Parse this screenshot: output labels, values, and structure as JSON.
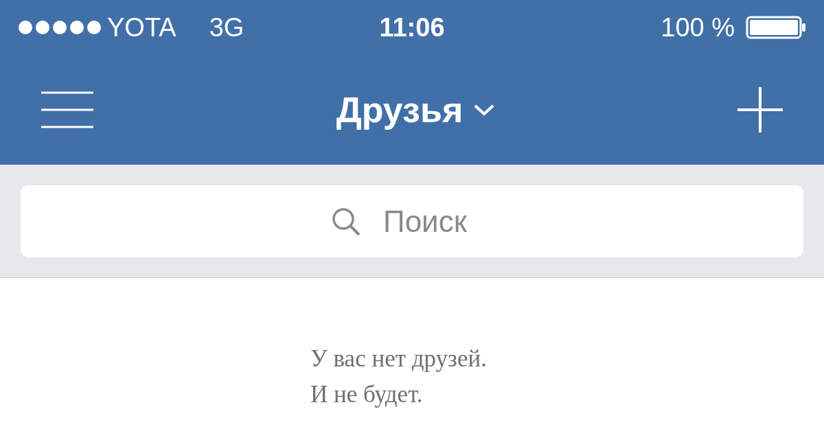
{
  "status_bar": {
    "carrier": "YOTA",
    "network": "3G",
    "time": "11:06",
    "battery": "100 %"
  },
  "nav": {
    "title": "Друзья"
  },
  "search": {
    "placeholder": "Поиск"
  },
  "message": [
    "У вас нет друзей.",
    "И не будет."
  ]
}
